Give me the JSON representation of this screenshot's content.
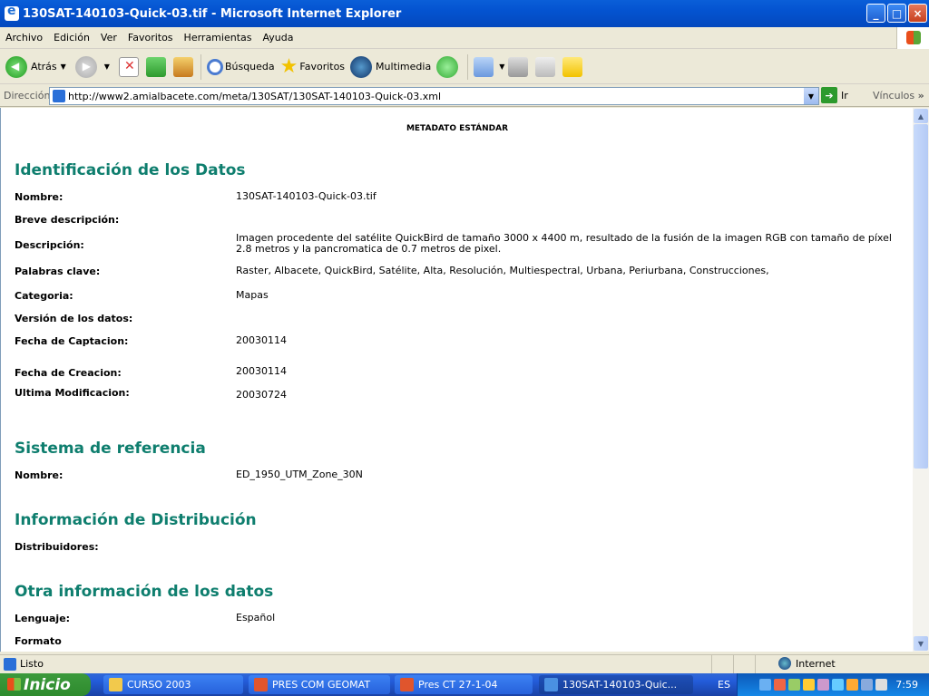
{
  "window": {
    "title": "130SAT-140103-Quick-03.tif - Microsoft Internet Explorer",
    "min": "_",
    "max": "□",
    "close": "×"
  },
  "menu": [
    "Archivo",
    "Edición",
    "Ver",
    "Favoritos",
    "Herramientas",
    "Ayuda"
  ],
  "toolbar": {
    "back": "Atrás",
    "search": "Búsqueda",
    "favorites": "Favoritos",
    "media": "Multimedia"
  },
  "address": {
    "label": "Dirección",
    "url": "http://www2.amialbacete.com/meta/130SAT/130SAT-140103-Quick-03.xml",
    "go": "Ir",
    "links": "Vínculos",
    "more": "»"
  },
  "doc": {
    "header": "METADATO ESTÁNDAR",
    "sections": {
      "identificacion": "Identificación de los Datos",
      "referencia": "Sistema de referencia",
      "distribucion": "Información de Distribución",
      "otra": "Otra información de los datos"
    },
    "fields": {
      "nombre_l": "Nombre:",
      "nombre_v": "130SAT-140103-Quick-03.tif",
      "breve_l": "Breve descripción:",
      "desc_l": "Descripción:",
      "desc_v": "Imagen procedente del satélite QuickBird de tamaño 3000 x 4400 m, resultado de la fusión de la imagen RGB con tamaño de píxel 2.8 metros y la pancromatica de 0.7 metros de pixel.",
      "kw_l": "Palabras clave:",
      "kw_v": "Raster, Albacete, QuickBird, Satélite, Alta, Resolución, Multiespectral, Urbana, Periurbana, Construcciones,",
      "cat_l": "Categoria:",
      "cat_v": "Mapas",
      "ver_l": "Versión de los datos:",
      "fcap_l": "Fecha de Captacion:",
      "fcap_v": "20030114",
      "fcre_l": "Fecha de Creacion:",
      "fcre_v": "20030114",
      "umod_l": "Ultima Modificacion:",
      "umod_v": "20030724",
      "refnombre_l": "Nombre:",
      "refnombre_v": "ED_1950_UTM_Zone_30N",
      "dist_l": "Distribuidores:",
      "leng_l": "Lenguaje:",
      "leng_v": "Español",
      "formato_l": "Formato"
    }
  },
  "status": {
    "text": "Listo",
    "zone": "Internet"
  },
  "taskbar": {
    "start": "Inicio",
    "tasks": [
      "CURSO 2003",
      "PRES COM GEOMAT",
      "Pres CT 27-1-04",
      "130SAT-140103-Quic..."
    ],
    "lang": "ES",
    "clock": "7:59"
  }
}
